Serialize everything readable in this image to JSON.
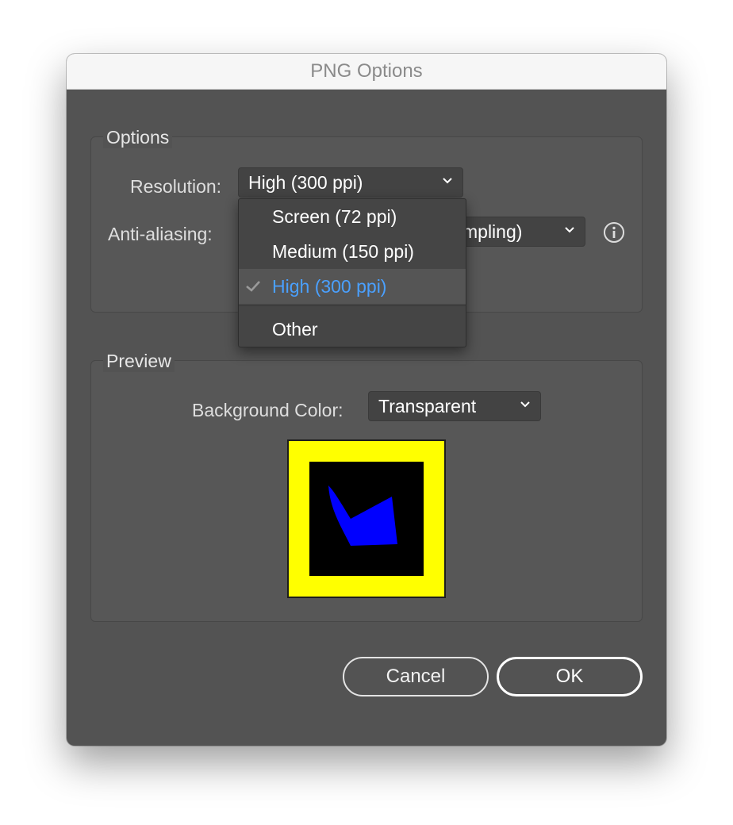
{
  "window": {
    "title": "PNG Options"
  },
  "options_group": {
    "label": "Options",
    "resolution": {
      "label": "Resolution:",
      "value": "High (300 ppi)"
    },
    "anti_aliasing": {
      "label": "Anti-aliasing:",
      "value_visible": "mpling)"
    }
  },
  "resolution_menu": {
    "items": [
      {
        "label": "Screen (72 ppi)",
        "selected": false
      },
      {
        "label": "Medium (150 ppi)",
        "selected": false
      },
      {
        "label": "High (300 ppi)",
        "selected": true
      },
      {
        "label": "Other",
        "selected": false
      }
    ]
  },
  "preview_group": {
    "label": "Preview",
    "background_color": {
      "label": "Background Color:",
      "value": "Transparent"
    },
    "colors": {
      "frame": "#ffff00",
      "inner": "#000000",
      "shape": "#0000ff"
    }
  },
  "buttons": {
    "cancel": "Cancel",
    "ok": "OK"
  },
  "colors": {
    "accent": "#4aa0ff",
    "dialog_bg": "#535353"
  },
  "icons": {
    "chevron": "chevron-down-icon",
    "info": "info-icon",
    "check": "checkmark-icon"
  }
}
